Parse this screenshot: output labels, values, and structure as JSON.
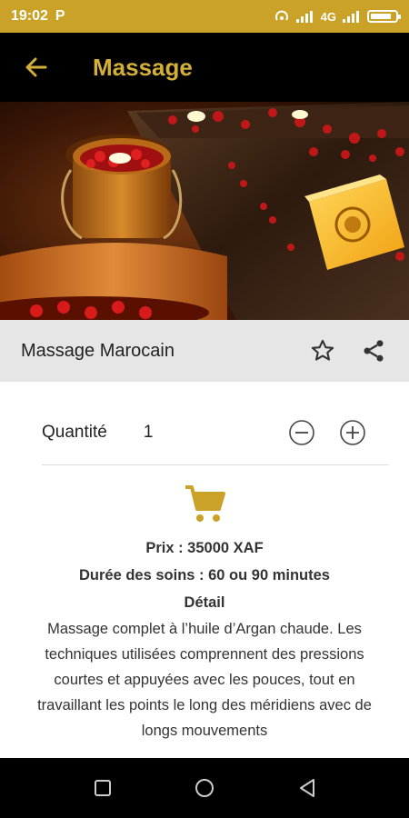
{
  "status_bar": {
    "time": "19:02",
    "notification_letter": "P",
    "network_label": "4G",
    "battery_level": 0.85
  },
  "app_bar": {
    "title": "Massage"
  },
  "product": {
    "name": "Massage Marocain"
  },
  "quantity": {
    "label": "Quantité",
    "value": "1"
  },
  "details": {
    "price": "Prix : 35000 XAF",
    "duration": "Durée des soins : 60 ou 90 minutes",
    "detail_heading": "Détail",
    "description": "Massage complet à l’huile d’Argan chaude. Les techniques utilisées comprennent des pressions courtes et appuyées avec les pouces, tout en travaillant les points le long des méridiens avec de longs mouvements"
  },
  "colors": {
    "accent": "#c9a227",
    "title_gold": "#d4af37",
    "bar_black": "#000000",
    "name_bar": "#e6e6e6"
  },
  "icons": [
    "back-arrow-icon",
    "star-icon",
    "share-icon",
    "minus-icon",
    "plus-icon",
    "cart-icon",
    "nav-recent-icon",
    "nav-home-icon",
    "nav-back-icon"
  ]
}
